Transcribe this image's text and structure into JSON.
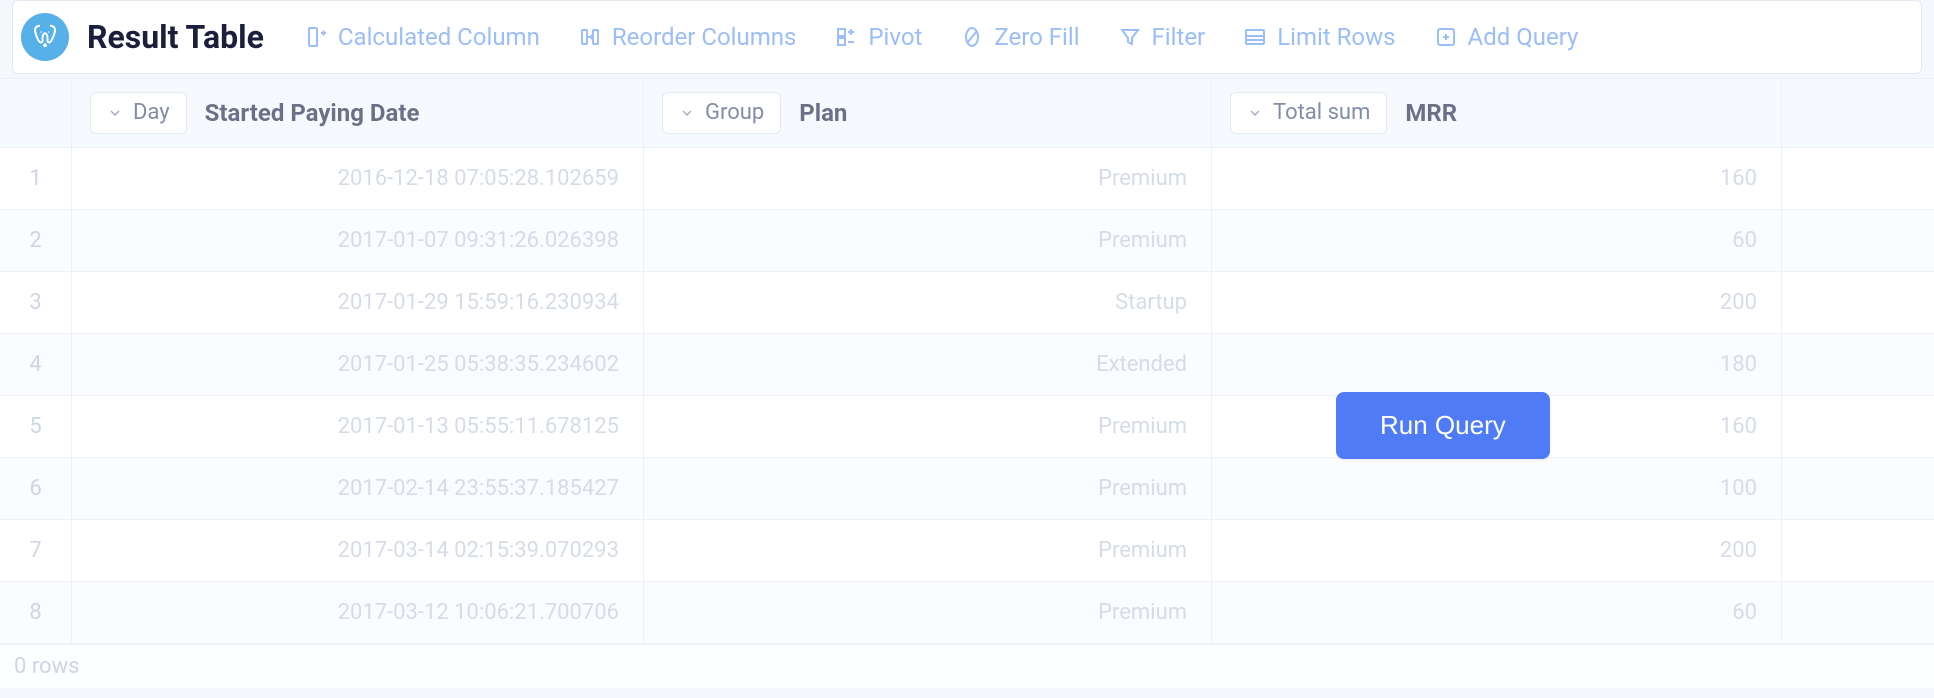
{
  "toolbar": {
    "title": "Result Table",
    "actions": {
      "calc_column": "Calculated Column",
      "reorder": "Reorder Columns",
      "pivot": "Pivot",
      "zero_fill": "Zero Fill",
      "filter": "Filter",
      "limit_rows": "Limit Rows",
      "add_query": "Add Query"
    }
  },
  "columns": {
    "date": {
      "pill": "Day",
      "label": "Started Paying Date"
    },
    "plan": {
      "pill": "Group",
      "label": "Plan"
    },
    "mrr": {
      "pill": "Total sum",
      "label": "MRR"
    }
  },
  "rows": [
    {
      "n": "1",
      "date": "2016-12-18 07:05:28.102659",
      "plan": "Premium",
      "mrr": "160"
    },
    {
      "n": "2",
      "date": "2017-01-07 09:31:26.026398",
      "plan": "Premium",
      "mrr": "60"
    },
    {
      "n": "3",
      "date": "2017-01-29 15:59:16.230934",
      "plan": "Startup",
      "mrr": "200"
    },
    {
      "n": "4",
      "date": "2017-01-25 05:38:35.234602",
      "plan": "Extended",
      "mrr": "180"
    },
    {
      "n": "5",
      "date": "2017-01-13 05:55:11.678125",
      "plan": "Premium",
      "mrr": "160"
    },
    {
      "n": "6",
      "date": "2017-02-14 23:55:37.185427",
      "plan": "Premium",
      "mrr": "100"
    },
    {
      "n": "7",
      "date": "2017-03-14 02:15:39.070293",
      "plan": "Premium",
      "mrr": "200"
    },
    {
      "n": "8",
      "date": "2017-03-12 10:06:21.700706",
      "plan": "Premium",
      "mrr": "60"
    }
  ],
  "footer": {
    "rows_text": "0 rows"
  },
  "overlay": {
    "run_button": "Run Query"
  }
}
